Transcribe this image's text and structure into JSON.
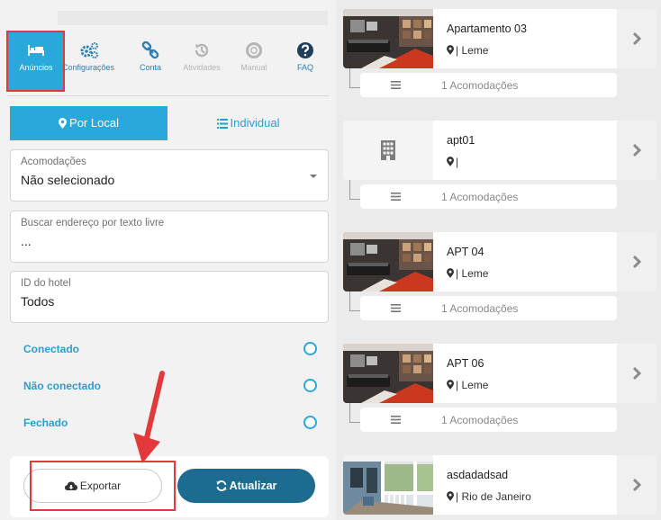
{
  "nav": {
    "items": [
      {
        "label": "Anúncios",
        "icon": "bed-icon",
        "state": "active"
      },
      {
        "label": "Configurações",
        "icon": "cogs-icon",
        "state": "normal"
      },
      {
        "label": "Conta",
        "icon": "link-icon",
        "state": "normal"
      },
      {
        "label": "Atividades",
        "icon": "history-icon",
        "state": "disabled"
      },
      {
        "label": "Manual",
        "icon": "lifebuoy-icon",
        "state": "disabled"
      },
      {
        "label": "FAQ",
        "icon": "question-icon",
        "state": "normal"
      }
    ]
  },
  "tabs": {
    "by_location": "Por Local",
    "individual": "Individual"
  },
  "filters": {
    "accommodations": {
      "label": "Acomodações",
      "value": "Não selecionado"
    },
    "address": {
      "label": "Buscar endereço por texto livre",
      "value": "..."
    },
    "hotel_id": {
      "label": "ID do hotel",
      "value": "Todos"
    }
  },
  "statuses": [
    {
      "label": "Conectado"
    },
    {
      "label": "Não conectado"
    },
    {
      "label": "Fechado"
    }
  ],
  "actions": {
    "export": "Exportar",
    "refresh": "Atualizar"
  },
  "listings": [
    {
      "title": "Apartamento 03",
      "location": "| Leme",
      "accommodations": "1 Acomodações",
      "thumb": "living-room"
    },
    {
      "title": "apt01",
      "location": "|",
      "accommodations": "1 Acomodações",
      "thumb": "building-icon"
    },
    {
      "title": "APT 04",
      "location": "| Leme",
      "accommodations": "1 Acomodações",
      "thumb": "living-room"
    },
    {
      "title": "APT 06",
      "location": "| Leme",
      "accommodations": "1 Acomodações",
      "thumb": "living-room"
    },
    {
      "title": "asdadadsad",
      "location": "| Rio de Janeiro",
      "accommodations": "",
      "thumb": "porch"
    }
  ],
  "colors": {
    "accent": "#29a8dc",
    "link": "#2a9fcf",
    "refresh_button": "#1d6c90",
    "annotation": "#e23a3a"
  }
}
